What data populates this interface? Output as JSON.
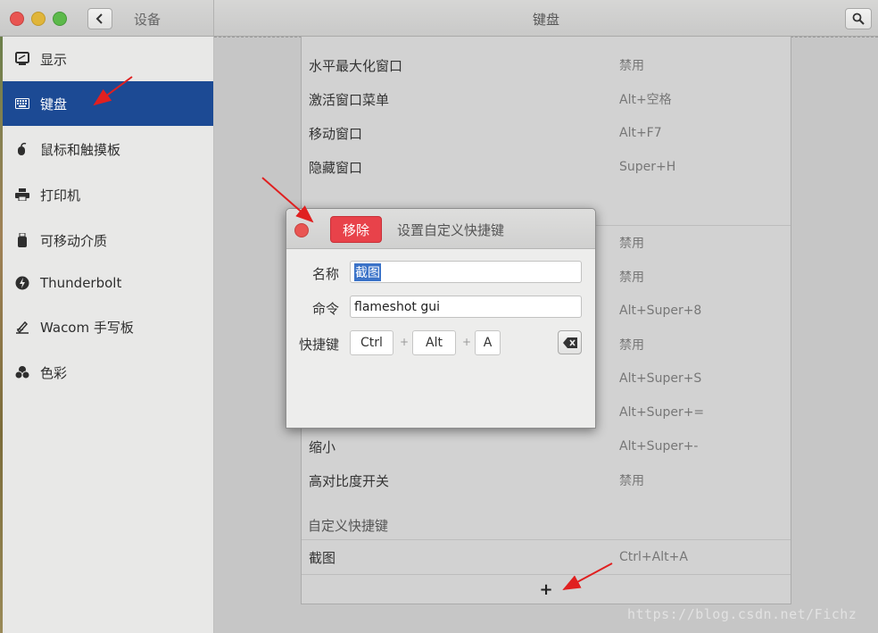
{
  "header": {
    "sidebar_title": "设备",
    "main_title": "键盘"
  },
  "sidebar": {
    "items": [
      {
        "label": "显示",
        "icon": "display-icon"
      },
      {
        "label": "键盘",
        "icon": "keyboard-icon",
        "active": true
      },
      {
        "label": "鼠标和触摸板",
        "icon": "mouse-icon"
      },
      {
        "label": "打印机",
        "icon": "printer-icon"
      },
      {
        "label": "可移动介质",
        "icon": "removable-media-icon"
      },
      {
        "label": "Thunderbolt",
        "icon": "thunderbolt-icon"
      },
      {
        "label": "Wacom 手写板",
        "icon": "tablet-icon"
      },
      {
        "label": "色彩",
        "icon": "color-icon"
      }
    ]
  },
  "shortcuts": {
    "rows_top": [
      {
        "name": "水平最大化窗口",
        "accel": "禁用"
      },
      {
        "name": "激活窗口菜单",
        "accel": "Alt+空格"
      },
      {
        "name": "移动窗口",
        "accel": "Alt+F7"
      },
      {
        "name": "隐藏窗口",
        "accel": "Super+H"
      }
    ],
    "rows_behind_dialog": [
      {
        "accel": "禁用"
      },
      {
        "accel": "禁用"
      },
      {
        "accel": "Alt+Super+8"
      },
      {
        "accel": "禁用"
      },
      {
        "accel": "Alt+Super+S"
      },
      {
        "accel": "Alt+Super+="
      }
    ],
    "rows_bottom": [
      {
        "name": "缩小",
        "accel": "Alt+Super+-"
      },
      {
        "name": "高对比度开关",
        "accel": "禁用"
      }
    ],
    "custom_section_label": "自定义快捷键",
    "custom_rows": [
      {
        "name": "截图",
        "accel": "Ctrl+Alt+A"
      }
    ],
    "add_label": "+"
  },
  "dialog": {
    "remove_label": "移除",
    "title": "设置自定义快捷键",
    "name_label": "名称",
    "name_value": "截图",
    "command_label": "命令",
    "command_value": "flameshot gui",
    "shortcut_label": "快捷键",
    "keys": [
      "Ctrl",
      "Alt",
      "A"
    ],
    "plus": "+"
  },
  "watermark": "https://blog.csdn.net/Fichz",
  "colors": {
    "sidebar_active": "#1c4a94",
    "remove_button": "#e8424a",
    "arrow": "#e02020"
  }
}
